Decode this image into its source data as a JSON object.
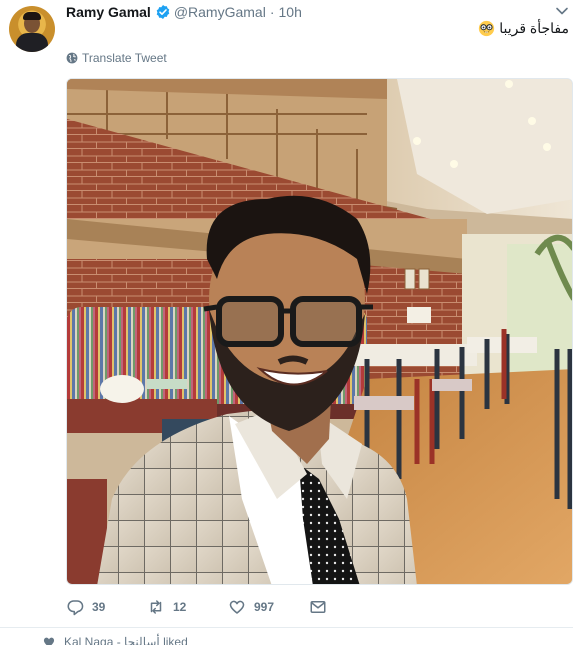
{
  "tweet": {
    "author": {
      "name": "Ramy Gamal",
      "handle": "@RamyGamal",
      "verified": true
    },
    "separator": "·",
    "time": "10h",
    "text": "مفاجأة قريبا",
    "emoji": "nerd-face-emoji",
    "translate_label": "Translate Tweet",
    "stats": {
      "replies": "39",
      "retweets": "12",
      "likes": "997"
    }
  },
  "next_activity": {
    "text": "Kal Naga - أسالنجا liked"
  },
  "colors": {
    "verified": "#1da1f2",
    "muted": "#657786",
    "text": "#14171a"
  }
}
